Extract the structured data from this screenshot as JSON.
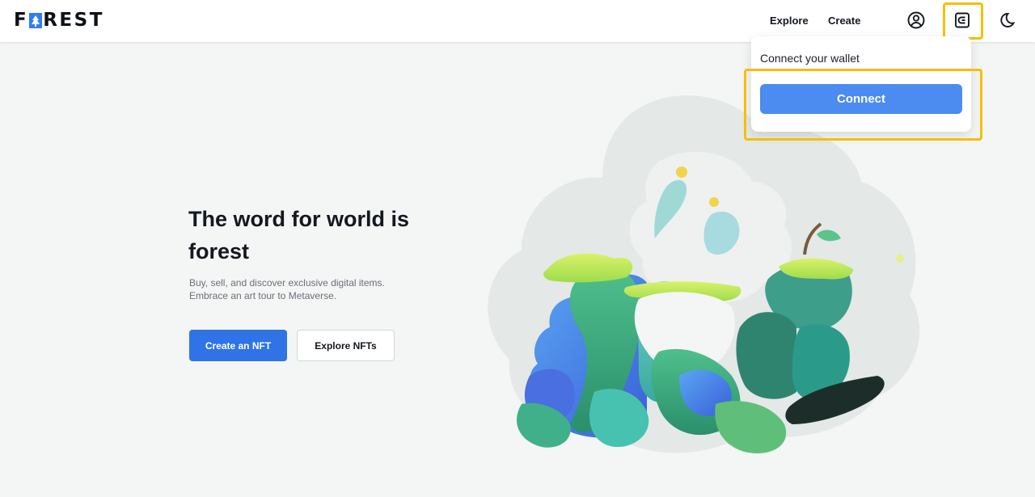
{
  "header": {
    "logo_left": "F",
    "logo_right": "REST",
    "nav": [
      {
        "label": "Explore"
      },
      {
        "label": "Create"
      }
    ],
    "icons": [
      "user-circle-icon",
      "wallet-icon",
      "moon-icon"
    ]
  },
  "wallet_dropdown": {
    "title": "Connect your wallet",
    "connect_label": "Connect"
  },
  "hero": {
    "title": "The word for world is forest",
    "subtitle_line1": "Buy, sell, and discover exclusive digital items.",
    "subtitle_line2": "Embrace an art tour to Metaverse.",
    "primary_button": "Create an NFT",
    "secondary_button": "Explore NFTs"
  },
  "colors": {
    "accent": "#2f73e6",
    "connect_button": "#4c8bf0",
    "highlight": "#f5bf0a",
    "logo_box": "#2f7df6"
  }
}
